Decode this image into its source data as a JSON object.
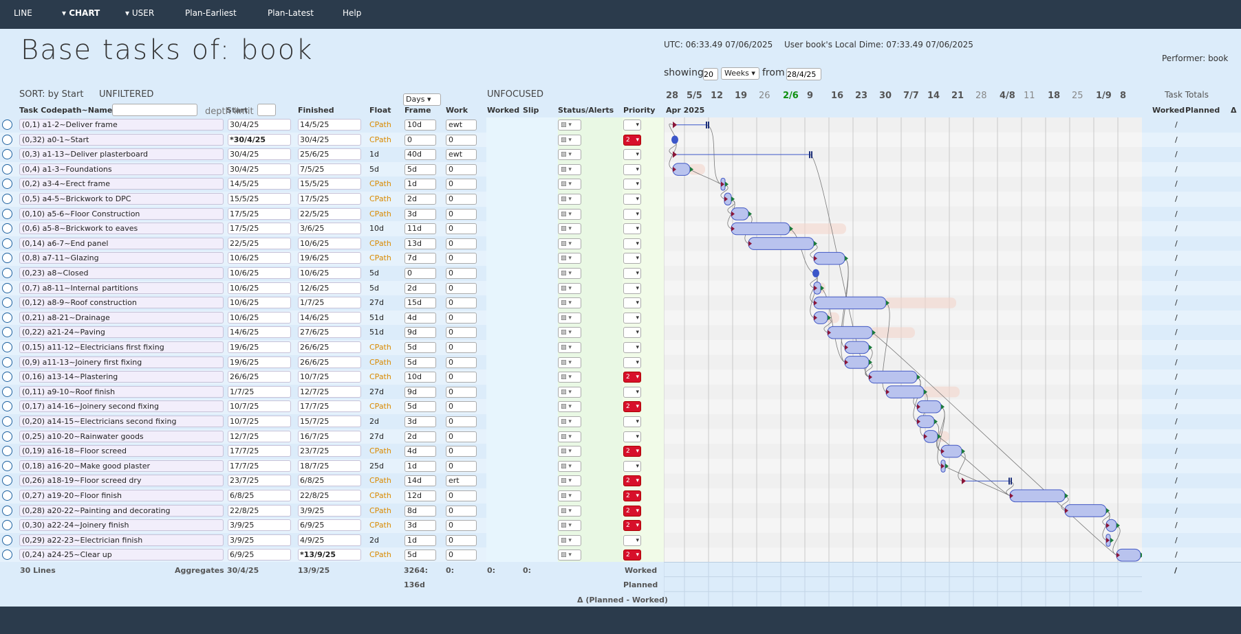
{
  "nav": {
    "line": "LINE",
    "chart": "▾ CHART",
    "user": "▾ USER",
    "plan_earliest": "Plan-Earliest",
    "plan_latest": "Plan-Latest",
    "help": "Help"
  },
  "header": {
    "title": "Base tasks of: book",
    "utc": "UTC: 06:33.49 07/06/2025",
    "local": "User book's Local Dime: 07:33.49 07/06/2025",
    "performer": "Performer: book",
    "showing_label": "showing",
    "showing_value": "20",
    "unit": "Weeks",
    "from_label": "from",
    "from_value": "28/4/25"
  },
  "toolbar": {
    "sort": "SORT: by Start",
    "filter": "UNFILTERED",
    "unfocused": "UNFOCUSED",
    "days": "Days",
    "task_totals": "Task Totals",
    "depth_limit": "depth limit"
  },
  "columns": {
    "name": "Task Codepath~Name",
    "start": "Start",
    "finished": "Finished",
    "float": "Float",
    "frame": "Frame",
    "work": "Work",
    "worked": "Worked",
    "slip": "Slip",
    "status": "Status/Alerts",
    "priority": "Priority",
    "month": "Apr 2025",
    "tot_worked": "Worked",
    "tot_planned": "Planned",
    "tot_delta": "Δ"
  },
  "weeks": [
    {
      "label": "28",
      "cls": "b"
    },
    {
      "label": "5/5",
      "cls": "b"
    },
    {
      "label": "12",
      "cls": "b"
    },
    {
      "label": "19",
      "cls": "b"
    },
    {
      "label": "26",
      "cls": "g"
    },
    {
      "label": "2/6",
      "cls": "gr"
    },
    {
      "label": "9",
      "cls": "b"
    },
    {
      "label": "16",
      "cls": "b"
    },
    {
      "label": "23",
      "cls": "b"
    },
    {
      "label": "30",
      "cls": "b"
    },
    {
      "label": "7/7",
      "cls": "b"
    },
    {
      "label": "14",
      "cls": "b"
    },
    {
      "label": "21",
      "cls": "b"
    },
    {
      "label": "28",
      "cls": "g"
    },
    {
      "label": "4/8",
      "cls": "b"
    },
    {
      "label": "11",
      "cls": "g"
    },
    {
      "label": "18",
      "cls": "b"
    },
    {
      "label": "25",
      "cls": "g"
    },
    {
      "label": "1/9",
      "cls": "b"
    },
    {
      "label": "8",
      "cls": "b"
    }
  ],
  "rows": [
    {
      "code": "(0,1)",
      "name": "a1-2~Deliver frame",
      "start": "30/4/25",
      "finished": "14/5/25",
      "float": "CPath",
      "frame": "10d",
      "work": "ewt",
      "prio": "",
      "s": 2,
      "d": 10
    },
    {
      "code": "(0,32)",
      "name": "a0-1~Start",
      "start": "*30/4/25",
      "finished": "30/4/25",
      "float": "CPath",
      "frame": "0",
      "work": "0",
      "prio": "2",
      "s": 2,
      "d": 0
    },
    {
      "code": "(0,3)",
      "name": "a1-13~Deliver plasterboard",
      "start": "30/4/25",
      "finished": "25/6/25",
      "float": "1d",
      "frame": "40d",
      "work": "ewt",
      "prio": "",
      "s": 2,
      "d": 40
    },
    {
      "code": "(0,4)",
      "name": "a1-3~Foundations",
      "start": "30/4/25",
      "finished": "7/5/25",
      "float": "5d",
      "frame": "5d",
      "work": "0",
      "prio": "",
      "s": 2,
      "d": 5
    },
    {
      "code": "(0,2)",
      "name": "a3-4~Erect frame",
      "start": "14/5/25",
      "finished": "15/5/25",
      "float": "CPath",
      "frame": "1d",
      "work": "0",
      "prio": "",
      "s": 16,
      "d": 1
    },
    {
      "code": "(0,5)",
      "name": "a4-5~Brickwork to DPC",
      "start": "15/5/25",
      "finished": "17/5/25",
      "float": "CPath",
      "frame": "2d",
      "work": "0",
      "prio": "",
      "s": 17,
      "d": 2
    },
    {
      "code": "(0,10)",
      "name": "a5-6~Floor Construction",
      "start": "17/5/25",
      "finished": "22/5/25",
      "float": "CPath",
      "frame": "3d",
      "work": "0",
      "prio": "",
      "s": 19,
      "d": 5
    },
    {
      "code": "(0,6)",
      "name": "a5-8~Brickwork to eaves",
      "start": "17/5/25",
      "finished": "3/6/25",
      "float": "10d",
      "frame": "11d",
      "work": "0",
      "prio": "",
      "s": 19,
      "d": 17
    },
    {
      "code": "(0,14)",
      "name": "a6-7~End panel",
      "start": "22/5/25",
      "finished": "10/6/25",
      "float": "CPath",
      "frame": "13d",
      "work": "0",
      "prio": "",
      "s": 24,
      "d": 19
    },
    {
      "code": "(0,8)",
      "name": "a7-11~Glazing",
      "start": "10/6/25",
      "finished": "19/6/25",
      "float": "CPath",
      "frame": "7d",
      "work": "0",
      "prio": "",
      "s": 43,
      "d": 9
    },
    {
      "code": "(0,23)",
      "name": "a8~Closed",
      "start": "10/6/25",
      "finished": "10/6/25",
      "float": "5d",
      "frame": "0",
      "work": "0",
      "prio": "",
      "s": 43,
      "d": 0
    },
    {
      "code": "(0,7)",
      "name": "a8-11~Internal partitions",
      "start": "10/6/25",
      "finished": "12/6/25",
      "float": "5d",
      "frame": "2d",
      "work": "0",
      "prio": "",
      "s": 43,
      "d": 2
    },
    {
      "code": "(0,12)",
      "name": "a8-9~Roof construction",
      "start": "10/6/25",
      "finished": "1/7/25",
      "float": "27d",
      "frame": "15d",
      "work": "0",
      "prio": "",
      "s": 43,
      "d": 21
    },
    {
      "code": "(0,21)",
      "name": "a8-21~Drainage",
      "start": "10/6/25",
      "finished": "14/6/25",
      "float": "51d",
      "frame": "4d",
      "work": "0",
      "prio": "",
      "s": 43,
      "d": 4
    },
    {
      "code": "(0,22)",
      "name": "a21-24~Paving",
      "start": "14/6/25",
      "finished": "27/6/25",
      "float": "51d",
      "frame": "9d",
      "work": "0",
      "prio": "",
      "s": 47,
      "d": 13
    },
    {
      "code": "(0,15)",
      "name": "a11-12~Electricians first fixing",
      "start": "19/6/25",
      "finished": "26/6/25",
      "float": "CPath",
      "frame": "5d",
      "work": "0",
      "prio": "",
      "s": 52,
      "d": 7
    },
    {
      "code": "(0,9)",
      "name": "a11-13~Joinery first fixing",
      "start": "19/6/25",
      "finished": "26/6/25",
      "float": "CPath",
      "frame": "5d",
      "work": "0",
      "prio": "",
      "s": 52,
      "d": 7
    },
    {
      "code": "(0,16)",
      "name": "a13-14~Plastering",
      "start": "26/6/25",
      "finished": "10/7/25",
      "float": "CPath",
      "frame": "10d",
      "work": "0",
      "prio": "2",
      "s": 59,
      "d": 14
    },
    {
      "code": "(0,11)",
      "name": "a9-10~Roof finish",
      "start": "1/7/25",
      "finished": "12/7/25",
      "float": "27d",
      "frame": "9d",
      "work": "0",
      "prio": "",
      "s": 64,
      "d": 11
    },
    {
      "code": "(0,17)",
      "name": "a14-16~Joinery second fixing",
      "start": "10/7/25",
      "finished": "17/7/25",
      "float": "CPath",
      "frame": "5d",
      "work": "0",
      "prio": "2",
      "s": 73,
      "d": 7
    },
    {
      "code": "(0,20)",
      "name": "a14-15~Electricians second fixing",
      "start": "10/7/25",
      "finished": "15/7/25",
      "float": "2d",
      "frame": "3d",
      "work": "0",
      "prio": "",
      "s": 73,
      "d": 5
    },
    {
      "code": "(0,25)",
      "name": "a10-20~Rainwater goods",
      "start": "12/7/25",
      "finished": "16/7/25",
      "float": "27d",
      "frame": "2d",
      "work": "0",
      "prio": "",
      "s": 75,
      "d": 4
    },
    {
      "code": "(0,19)",
      "name": "a16-18~Floor screed",
      "start": "17/7/25",
      "finished": "23/7/25",
      "float": "CPath",
      "frame": "4d",
      "work": "0",
      "prio": "2",
      "s": 80,
      "d": 6
    },
    {
      "code": "(0,18)",
      "name": "a16-20~Make good plaster",
      "start": "17/7/25",
      "finished": "18/7/25",
      "float": "25d",
      "frame": "1d",
      "work": "0",
      "prio": "",
      "s": 80,
      "d": 1
    },
    {
      "code": "(0,26)",
      "name": "a18-19~Floor screed dry",
      "start": "23/7/25",
      "finished": "6/8/25",
      "float": "CPath",
      "frame": "14d",
      "work": "ert",
      "prio": "2",
      "s": 86,
      "d": 14
    },
    {
      "code": "(0,27)",
      "name": "a19-20~Floor finish",
      "start": "6/8/25",
      "finished": "22/8/25",
      "float": "CPath",
      "frame": "12d",
      "work": "0",
      "prio": "2",
      "s": 100,
      "d": 16
    },
    {
      "code": "(0,28)",
      "name": "a20-22~Painting and decorating",
      "start": "22/8/25",
      "finished": "3/9/25",
      "float": "CPath",
      "frame": "8d",
      "work": "0",
      "prio": "2",
      "s": 116,
      "d": 12
    },
    {
      "code": "(0,30)",
      "name": "a22-24~Joinery finish",
      "start": "3/9/25",
      "finished": "6/9/25",
      "float": "CPath",
      "frame": "3d",
      "work": "0",
      "prio": "2",
      "s": 128,
      "d": 3
    },
    {
      "code": "(0,29)",
      "name": "a22-23~Electrician finish",
      "start": "3/9/25",
      "finished": "4/9/25",
      "float": "2d",
      "frame": "1d",
      "work": "0",
      "prio": "",
      "s": 128,
      "d": 1
    },
    {
      "code": "(0,24)",
      "name": "a24-25~Clear up",
      "start": "6/9/25",
      "finished": "*13/9/25",
      "float": "CPath",
      "frame": "5d",
      "work": "0",
      "prio": "2",
      "s": 131,
      "d": 7
    }
  ],
  "footer": {
    "lines": "30 Lines",
    "aggregates": "Aggregates",
    "agg_start": "30/4/25",
    "agg_finished": "13/9/25",
    "frame_total": "3264:",
    "frame_days": "136d",
    "work_total": "0:",
    "worked_total": "0:",
    "slip_total": "0:",
    "worked": "Worked",
    "planned": "Planned",
    "delta": "Δ (Planned - Worked)",
    "slash": "/"
  },
  "row_slash": "/",
  "colors": {
    "bar_fill": "#b9c3ee",
    "bar_stroke": "#4258c4",
    "cpath": "#d98a00",
    "prio_hi": "#d7102b",
    "green_week": "#0d8f0d"
  }
}
